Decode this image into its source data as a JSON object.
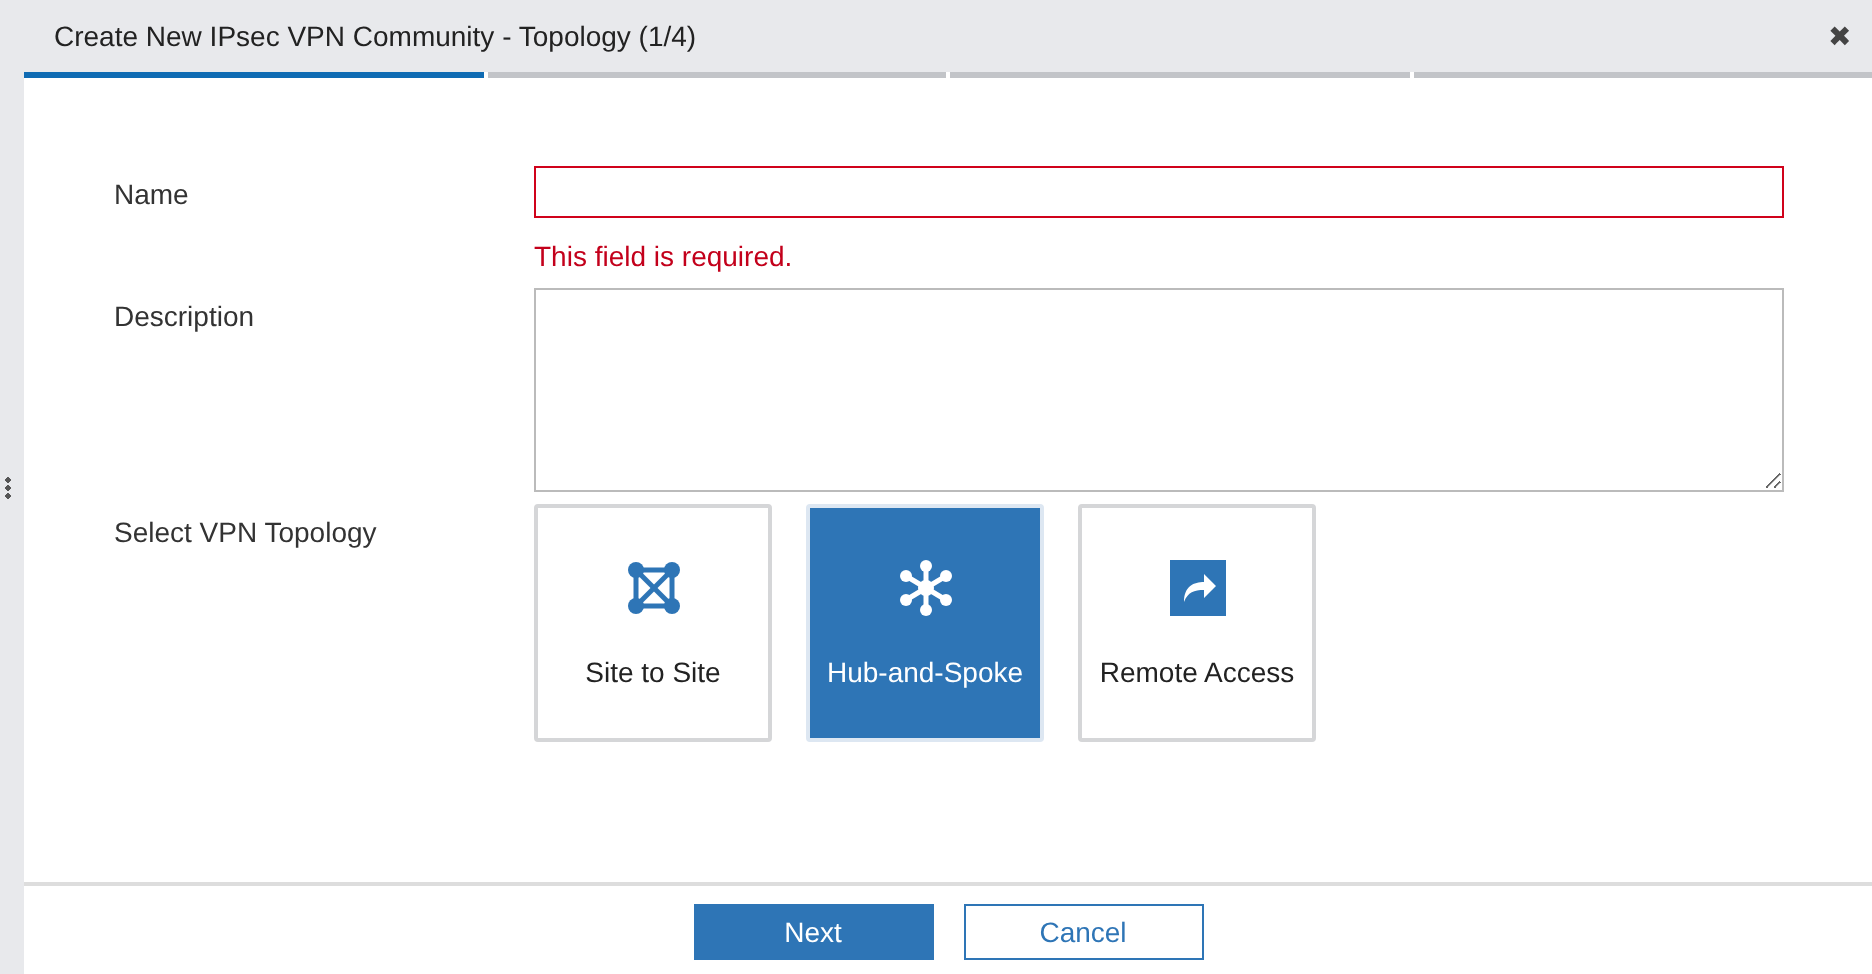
{
  "window": {
    "title": "Create New IPsec VPN Community - Topology (1/4)",
    "close": "✖"
  },
  "steps": [
    {
      "selected": true
    },
    {
      "selected": false
    },
    {
      "selected": false
    },
    {
      "selected": false
    }
  ],
  "form": {
    "name": {
      "label": "Name",
      "error": "This field is required.",
      "invalid": true
    },
    "description": {
      "label": "Description"
    },
    "topology": {
      "label": "Select VPN Topology",
      "options": [
        {
          "kind": "mesh",
          "label": "Site to Site",
          "selected": false
        },
        {
          "kind": "hub",
          "label": "Hub-and-Spoke",
          "selected": true
        },
        {
          "kind": "remote",
          "label": "Remote Access",
          "selected": false
        }
      ]
    }
  },
  "buttons": [
    {
      "label": "Next",
      "kind": "primary"
    },
    {
      "label": "Cancel",
      "kind": "secondary"
    }
  ]
}
